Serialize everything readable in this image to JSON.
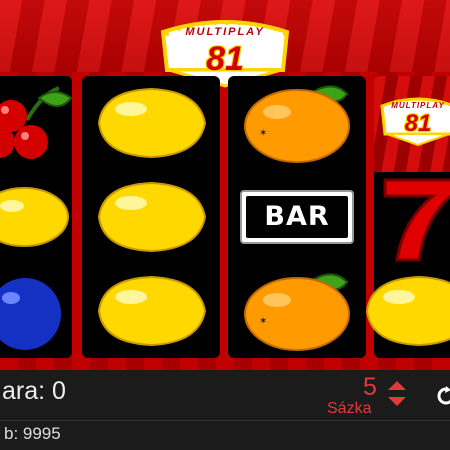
{
  "game": {
    "logo_top": "MULTIPLAY",
    "logo_number": "81",
    "mini_logo_top": "MULTIPLAY",
    "mini_logo_number": "81"
  },
  "reels": [
    {
      "name": "reel-1",
      "symbols": [
        "cherries",
        "lemon",
        "plum"
      ]
    },
    {
      "name": "reel-2",
      "symbols": [
        "lemon",
        "lemon",
        "lemon"
      ]
    },
    {
      "name": "reel-3",
      "symbols": [
        "orange",
        "bar",
        "orange"
      ]
    },
    {
      "name": "reel-4",
      "symbols": [
        "multiplay-logo",
        "seven",
        "lemon"
      ]
    }
  ],
  "bar_text": "BAR",
  "footer": {
    "win_label": "ara: 0",
    "credit_label": "b: 9995",
    "bet_value": "5",
    "bet_label": "Sázka"
  },
  "icons": {
    "bet_up": "arrow-up-icon",
    "bet_down": "arrow-down-icon",
    "spin": "spin-icon"
  },
  "colors": {
    "background_red": "#c10000",
    "reel_bg": "#000000",
    "footer_bg": "#1b1b1b",
    "accent_red": "#e23a3a",
    "logo_gold": "#ffd400"
  }
}
